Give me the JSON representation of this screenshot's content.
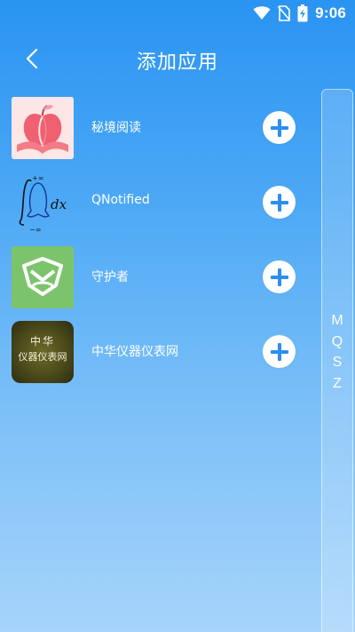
{
  "status_bar": {
    "time": "9:06",
    "icons": [
      "wifi-icon",
      "no-sim-icon",
      "battery-charging-icon"
    ]
  },
  "header": {
    "back_icon": "chevron-left-icon",
    "title": "添加应用"
  },
  "apps": [
    {
      "name": "秘境阅读",
      "icon": "apple-book-icon",
      "action_icon": "plus-icon"
    },
    {
      "name": "QNotified",
      "icon": "integral-qq-icon",
      "action_icon": "plus-icon"
    },
    {
      "name": "守护者",
      "icon": "shield-emblem-icon",
      "action_icon": "plus-icon"
    },
    {
      "name": "中华仪器仪表网",
      "icon": "instrument-net-icon",
      "icon_text_top": "中华",
      "icon_text_bottom": "仪器仪表网",
      "action_icon": "plus-icon"
    }
  ],
  "index_bar": {
    "letters": [
      "M",
      "Q",
      "S",
      "Z"
    ]
  },
  "colors": {
    "accent": "#2196f3",
    "bg_top": "#2a94f2",
    "bg_bottom": "#a6d4fa",
    "surface": "#ffffff"
  }
}
